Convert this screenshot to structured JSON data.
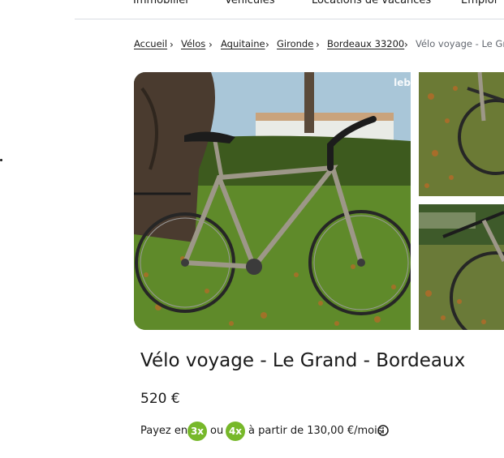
{
  "topnav": {
    "items": [
      "Immobilier",
      "Véhicules",
      "Locations de vacances",
      "Emploi"
    ]
  },
  "breadcrumb": {
    "items": [
      "Accueil",
      "Vélos",
      "Aquitaine",
      "Gironde",
      "Bordeaux 33200"
    ],
    "current": "Vélo voyage - Le Gra"
  },
  "gallery": {
    "watermark": "leb"
  },
  "listing": {
    "title": "Vélo voyage - Le Grand - Bordeaux",
    "price": "520 €"
  },
  "payment": {
    "prefix": "Payez en",
    "option1": "3x",
    "middle": "ou",
    "option2": "4x",
    "suffix": "à partir de 130,00 €/mois"
  },
  "colors": {
    "accent_green": "#77b82a",
    "text": "#1a1a1a",
    "divider": "#d9dde3"
  },
  "icons": [
    "chevron-right-icon",
    "info-icon"
  ]
}
